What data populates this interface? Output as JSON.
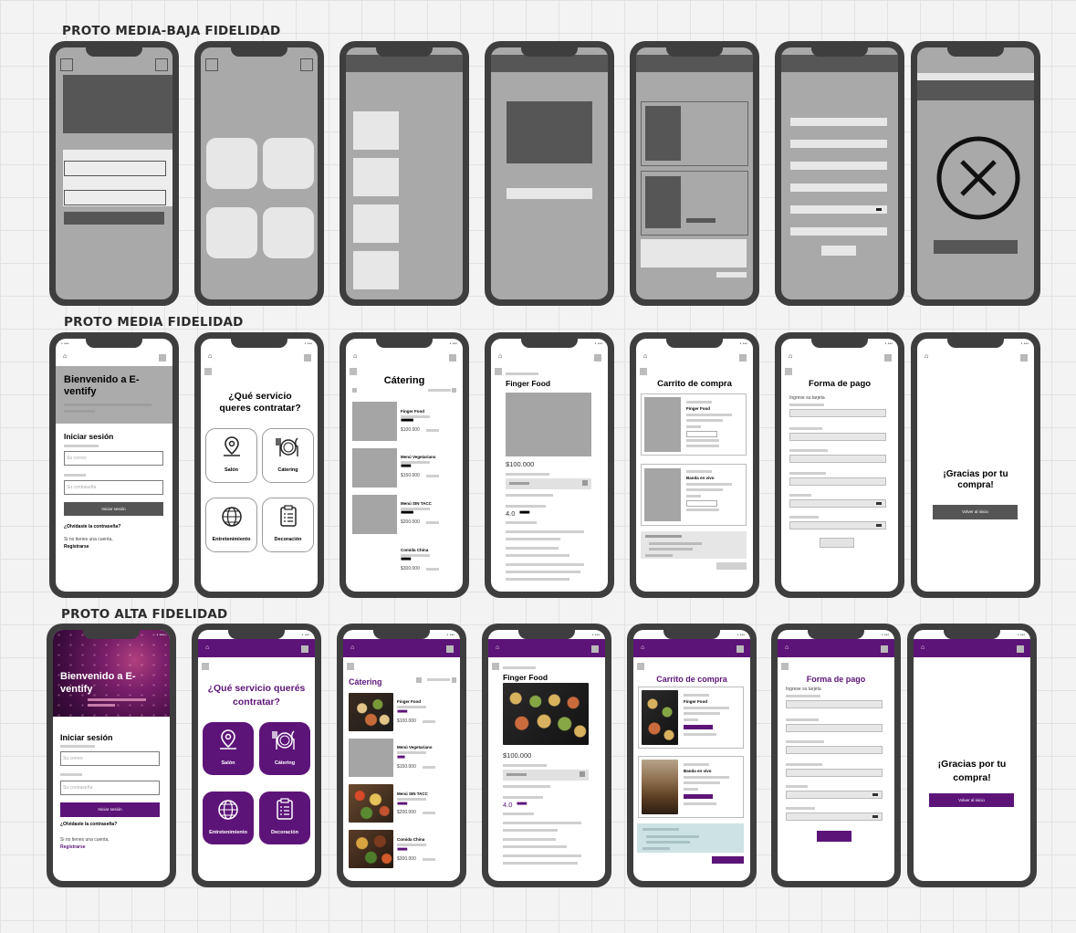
{
  "rows": {
    "low": {
      "title": "PROTO MEDIA-BAJA FIDELIDAD"
    },
    "mid": {
      "title": "PROTO MEDIA FIDELIDAD"
    },
    "high": {
      "title": "PROTO ALTA FIDELIDAD"
    }
  },
  "status_text": "• ••• ",
  "login": {
    "welcome_mid": "Bienvenido a E-ventify",
    "welcome_high": "Bienvenido a E-ventify",
    "heading": "Iniciar sesión",
    "email_placeholder": "Su correo",
    "password_placeholder": "Su contraseña",
    "button": "Iniciar sesión",
    "forgot": "¿Olvidaste la contraseña?",
    "no_account": "Si no tienes una cuenta,",
    "register": "Registrarse"
  },
  "services": {
    "question_mid": "¿Qué servicio queres contratar?",
    "question_high": "¿Qué servicio querés contratar?",
    "items": [
      {
        "label": "Salón",
        "icon": "map-pin-icon"
      },
      {
        "label": "Cátering",
        "icon": "plate-cutlery-icon"
      },
      {
        "label": "Entretenimiento",
        "icon": "globe-icon"
      },
      {
        "label": "Decoración",
        "icon": "clipboard-list-icon"
      }
    ]
  },
  "catering": {
    "title": "Cátering",
    "items": [
      {
        "name": "Finger Food",
        "price": "$100.000"
      },
      {
        "name": "Menú Vegetariano",
        "price": "$150.000"
      },
      {
        "name": "Menú SIN TACC",
        "price": "$200.000"
      },
      {
        "name": "Comida China",
        "price": "$300.000"
      }
    ]
  },
  "product": {
    "title": "Finger Food",
    "price": "$100.000",
    "rating": "4.0"
  },
  "cart": {
    "title": "Carrito de compra",
    "items": [
      {
        "name": "Finger Food"
      },
      {
        "name": "Banda en vivo"
      }
    ]
  },
  "payment": {
    "title": "Forma de pago",
    "card_label": "Ingrese su tarjeta"
  },
  "thanks": {
    "message": "¡Gracias por tu compra!",
    "button": "Volver al inicio"
  },
  "colors": {
    "brand_purple": "#5d1478",
    "wire_gray": "#a5a5a5",
    "wire_dark": "#565656",
    "phone_frame": "#3e3e3e"
  }
}
